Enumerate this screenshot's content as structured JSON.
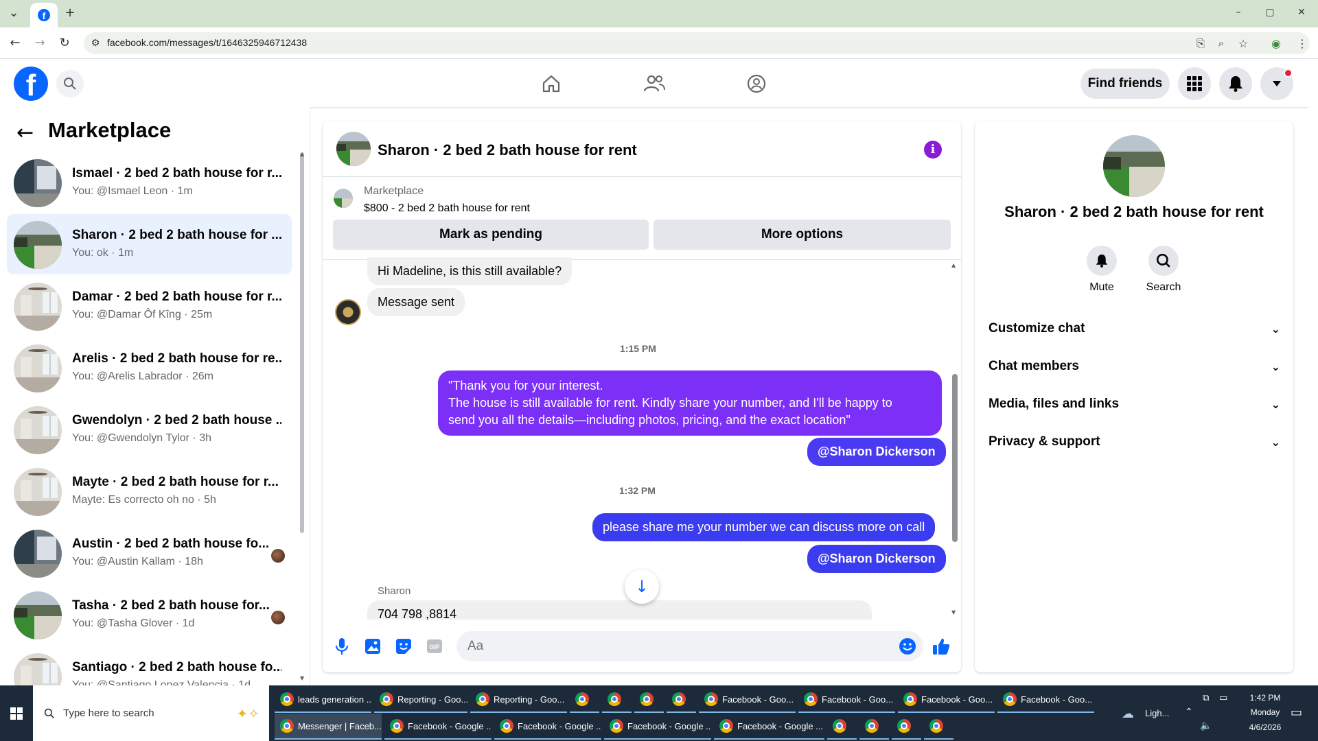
{
  "browser": {
    "url": "facebook.com/messages/t/1646325946712438",
    "new_tab": "+",
    "win_min": "–",
    "win_max": "▢",
    "win_close": "✕"
  },
  "header": {
    "find_friends": "Find friends"
  },
  "marketplace": {
    "title": "Marketplace",
    "conversations": [
      {
        "title": "Ismael · 2 bed 2 bath house for r...",
        "sub": "You: @Ismael Leon · 1m",
        "thumb": "interior-dark"
      },
      {
        "title": "Sharon · 2 bed 2 bath house for ...",
        "sub": "You: ok · 1m",
        "thumb": "exterior"
      },
      {
        "title": "Damar · 2 bed 2 bath house for r...",
        "sub": "You: @Damar Ôf Kîng · 25m",
        "thumb": "interior-light"
      },
      {
        "title": "Arelis · 2 bed 2 bath house for re...",
        "sub": "You: @Arelis Labrador · 26m",
        "thumb": "interior-light"
      },
      {
        "title": "Gwendolyn · 2 bed 2 bath house ...",
        "sub": "You: @Gwendolyn Tylor · 3h",
        "thumb": "interior-light"
      },
      {
        "title": "Mayte · 2 bed 2 bath house for r...",
        "sub": "Mayte: Es correcto oh no · 5h",
        "thumb": "interior-light"
      },
      {
        "title": "Austin · 2 bed 2 bath house fo...",
        "sub": "You: @Austin Kallam · 18h",
        "thumb": "interior-dark"
      },
      {
        "title": "Tasha · 2 bed 2 bath house for...",
        "sub": "You: @Tasha Glover · 1d",
        "thumb": "exterior"
      },
      {
        "title": "Santiago · 2 bed 2 bath house fo...",
        "sub": "You: @Santiago Lopez Valencia · 1d",
        "thumb": "interior-light"
      }
    ]
  },
  "chat": {
    "title": "Sharon · 2 bed 2 bath house for rent",
    "info": "i",
    "listing_label": "Marketplace",
    "listing": "$800 - 2 bed 2 bath house for rent",
    "mark_pending": "Mark as pending",
    "more_options": "More options",
    "msg_in_1": "Hi Madeline, is this still available?",
    "msg_in_2": "Message sent",
    "ts_1": "1:15 PM",
    "msg_out_1_line1": "\"Thank you for your interest.",
    "msg_out_1_line2": "The house is still available for rent. Kindly share your number, and I'll be happy to",
    "msg_out_1_line3": "send you all the details—including photos, pricing, and the exact location\"",
    "mention": "@Sharon Dickerson",
    "ts_2": "1:32 PM",
    "msg_out_2": "please share me your number we can discuss more on call",
    "sender": "Sharon",
    "msg_in_3": "704 798 ,8814",
    "composer_placeholder": "Aa"
  },
  "details": {
    "name": "Sharon · 2 bed 2 bath house for rent",
    "mute": "Mute",
    "search": "Search",
    "rows": [
      "Customize chat",
      "Chat members",
      "Media, files and links",
      "Privacy & support"
    ]
  },
  "taskbar": {
    "search_placeholder": "Type here to search",
    "row1": [
      "leads generation ...",
      "Reporting - Goo...",
      "Reporting - Goo...",
      "",
      "",
      "",
      "",
      "Facebook - Goo...",
      "Facebook - Goo...",
      "Facebook - Goo...",
      "Facebook - Goo..."
    ],
    "row2": [
      "Messenger | Faceb...",
      "Facebook - Google ...",
      "Facebook - Google ...",
      "Facebook - Google ...",
      "Facebook - Google ...",
      "",
      "",
      "",
      ""
    ],
    "weather": "Ligh...",
    "time": "1:42 PM",
    "day": "Monday",
    "date": "4/6/2026"
  },
  "colors": {
    "fb_blue": "#0866ff",
    "bubble_purple": "#7b2ff7",
    "bubble_blue": "#3b3bf0",
    "active_row": "#e9f1fe"
  }
}
